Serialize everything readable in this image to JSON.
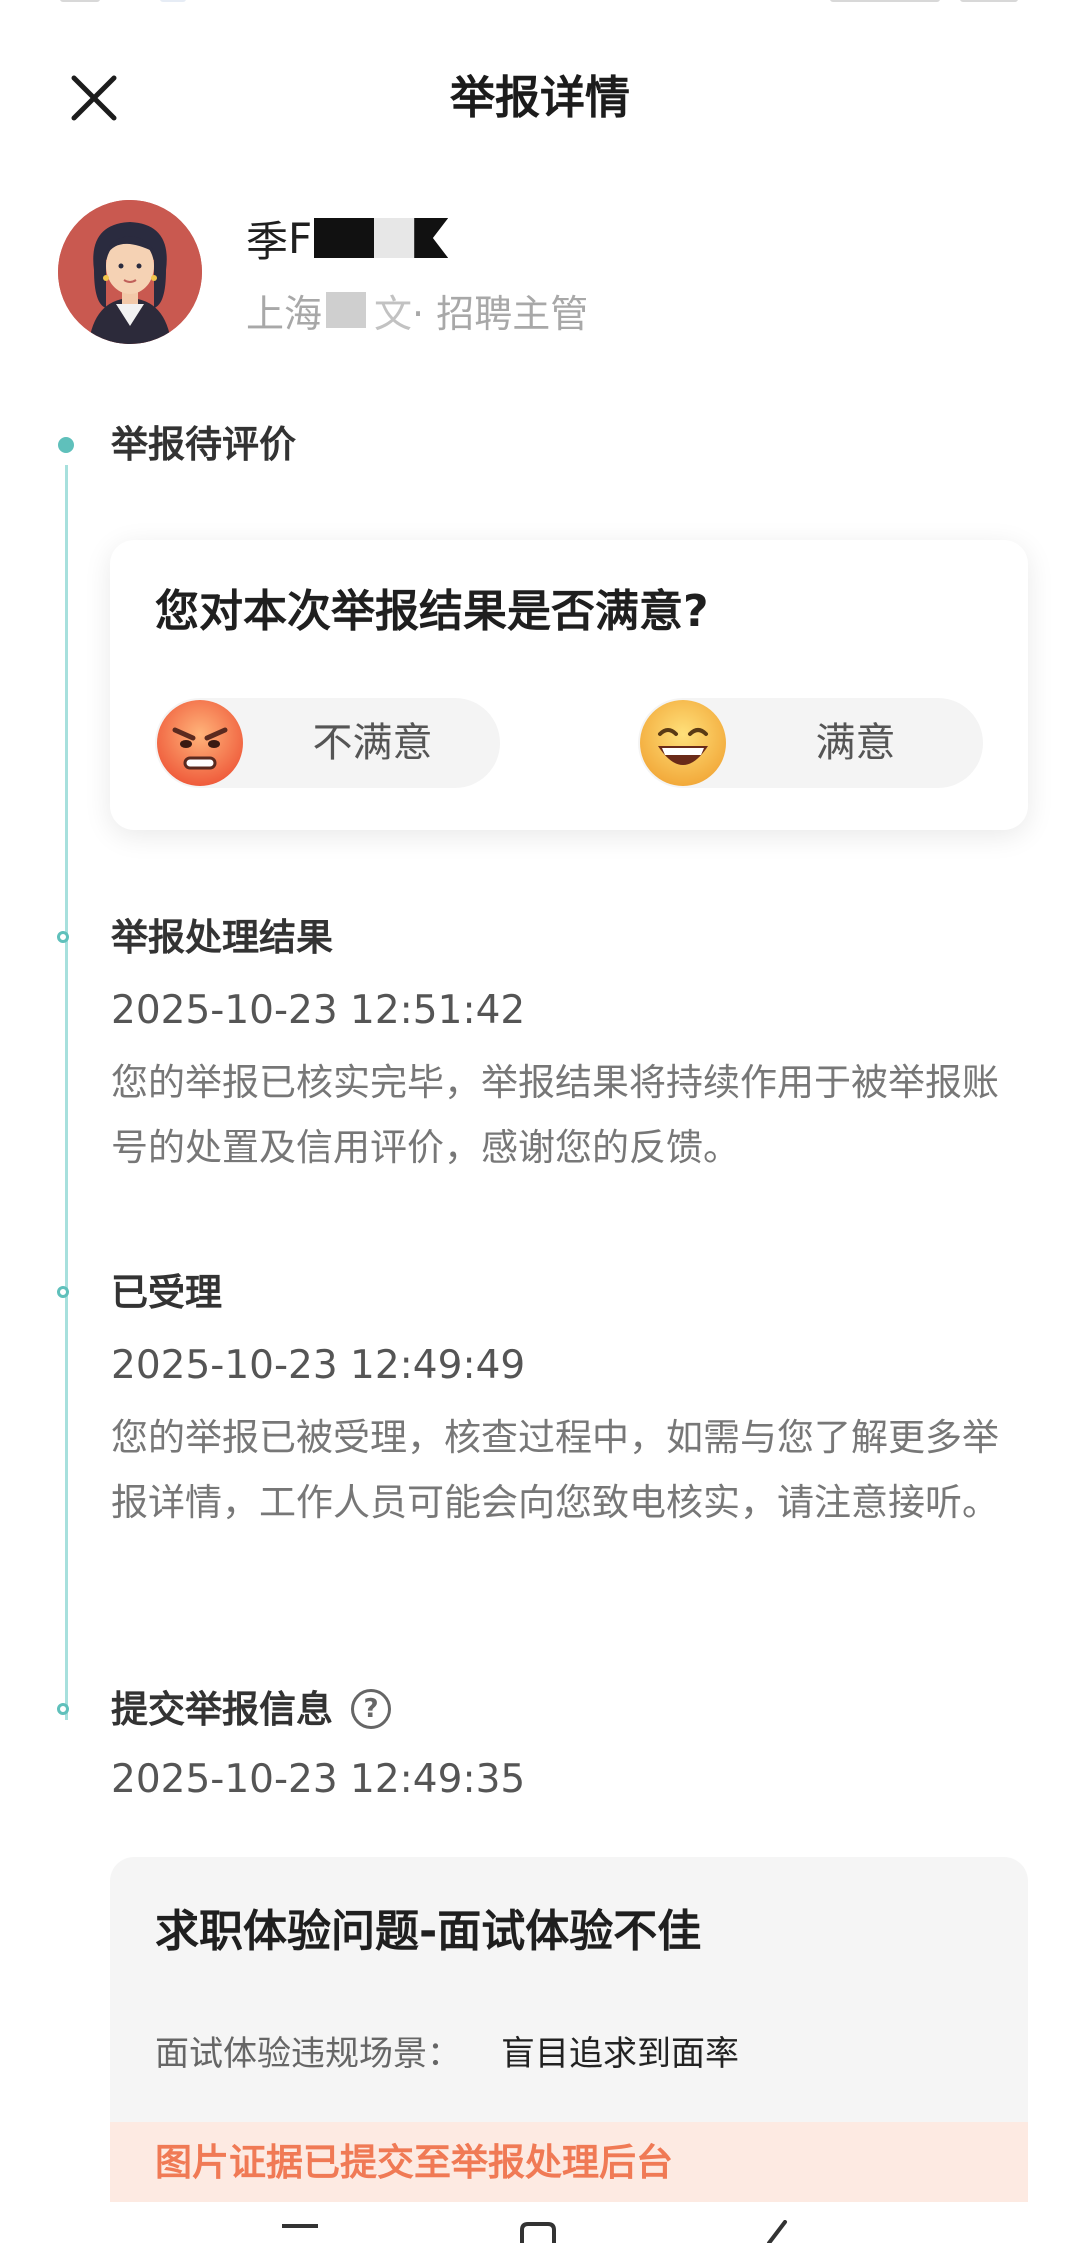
{
  "header": {
    "title": "举报详情"
  },
  "profile": {
    "name_prefix": "季",
    "name_partial": "F",
    "location": "上海",
    "location_suffix": "文",
    "role": " · 招聘主管"
  },
  "timeline": [
    {
      "title": "举报待评价"
    },
    {
      "title": "举报处理结果",
      "time": "2025-10-23 12:51:42",
      "body": "您的举报已核实完毕，举报结果将持续作用于被举报账号的处置及信用评价，感谢您的反馈。"
    },
    {
      "title": "已受理",
      "time": "2025-10-23 12:49:49",
      "body": "您的举报已被受理，核查过程中，如需与您了解更多举报详情，工作人员可能会向您致电核实，请注意接听。"
    },
    {
      "title": "提交举报信息",
      "time": "2025-10-23 12:49:35"
    }
  ],
  "rating": {
    "question": "您对本次举报结果是否满意?",
    "dissatisfied_label": "不满意",
    "satisfied_label": "满意"
  },
  "help_icon": {
    "glyph": "?"
  },
  "report": {
    "title": "求职体验问题-面试体验不佳",
    "field_label": "面试体验违规场景：",
    "field_value": "盲目追求到面率",
    "evidence_notice": "图片证据已提交至举报处理后台"
  },
  "colors": {
    "timeline": "#5fc0bb",
    "timeline_line": "#a7e0dd",
    "evidence_text": "#f07a55",
    "evidence_bg": "#fdeae2"
  },
  "icons": {
    "close": "close-icon",
    "angry": "angry-face-icon",
    "happy": "laughing-face-icon",
    "help": "question-circle-icon"
  }
}
